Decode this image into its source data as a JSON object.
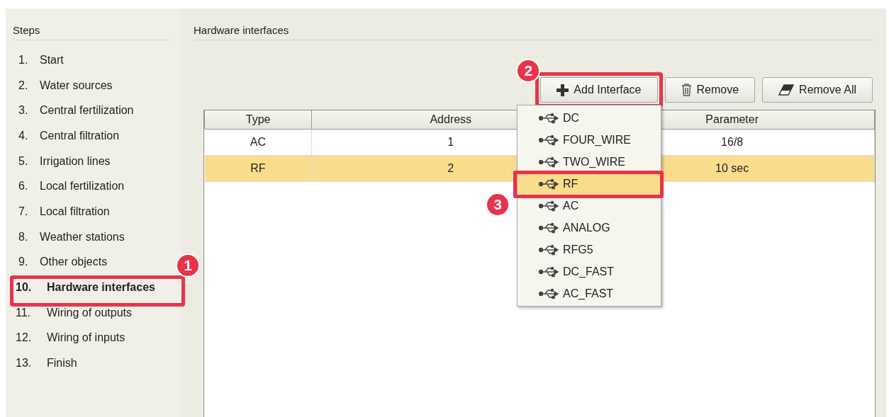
{
  "sidebar": {
    "title": "Steps",
    "items": [
      {
        "number": "1.",
        "label": "Start",
        "selected": false,
        "highlighted": false
      },
      {
        "number": "2.",
        "label": "Water sources",
        "selected": false,
        "highlighted": false
      },
      {
        "number": "3.",
        "label": "Central fertilization",
        "selected": false,
        "highlighted": false
      },
      {
        "number": "4.",
        "label": "Central filtration",
        "selected": false,
        "highlighted": false
      },
      {
        "number": "5.",
        "label": "Irrigation lines",
        "selected": false,
        "highlighted": false
      },
      {
        "number": "6.",
        "label": "Local fertilization",
        "selected": false,
        "highlighted": false
      },
      {
        "number": "7.",
        "label": "Local filtration",
        "selected": false,
        "highlighted": false
      },
      {
        "number": "8.",
        "label": "Weather stations",
        "selected": false,
        "highlighted": false
      },
      {
        "number": "9.",
        "label": "Other objects",
        "selected": false,
        "highlighted": false
      },
      {
        "number": "10.",
        "label": "Hardware interfaces",
        "selected": true,
        "highlighted": true,
        "callout": "1"
      },
      {
        "number": "11.",
        "label": "Wiring of outputs",
        "selected": false,
        "highlighted": false
      },
      {
        "number": "12.",
        "label": "Wiring of inputs",
        "selected": false,
        "highlighted": false
      },
      {
        "number": "13.",
        "label": "Finish",
        "selected": false,
        "highlighted": false
      }
    ]
  },
  "panel": {
    "title": "Hardware interfaces",
    "buttons": [
      {
        "label": "Add Interface",
        "kind": "add",
        "highlighted": true,
        "callout": "2"
      },
      {
        "label": "Remove",
        "kind": "remove",
        "highlighted": false
      },
      {
        "label": "Remove All",
        "kind": "clear",
        "highlighted": false
      }
    ],
    "table": {
      "columns": [
        "Type",
        "Address",
        "Parameter"
      ],
      "rows": [
        {
          "cells": [
            "AC",
            "1",
            "16/8"
          ],
          "selected": false
        },
        {
          "cells": [
            "RF",
            "2",
            "10 sec"
          ],
          "selected": true
        }
      ]
    },
    "menu": {
      "items": [
        {
          "label": "DC",
          "selected": false,
          "highlighted": false
        },
        {
          "label": "FOUR_WIRE",
          "selected": false,
          "highlighted": false
        },
        {
          "label": "TWO_WIRE",
          "selected": false,
          "highlighted": false
        },
        {
          "label": "RF",
          "selected": true,
          "highlighted": true,
          "callout": "3"
        },
        {
          "label": "AC",
          "selected": false,
          "highlighted": false
        },
        {
          "label": "ANALOG",
          "selected": false,
          "highlighted": false
        },
        {
          "label": "RFG5",
          "selected": false,
          "highlighted": false
        },
        {
          "label": "DC_FAST",
          "selected": false,
          "highlighted": false
        },
        {
          "label": "AC_FAST",
          "selected": false,
          "highlighted": false
        }
      ]
    }
  }
}
